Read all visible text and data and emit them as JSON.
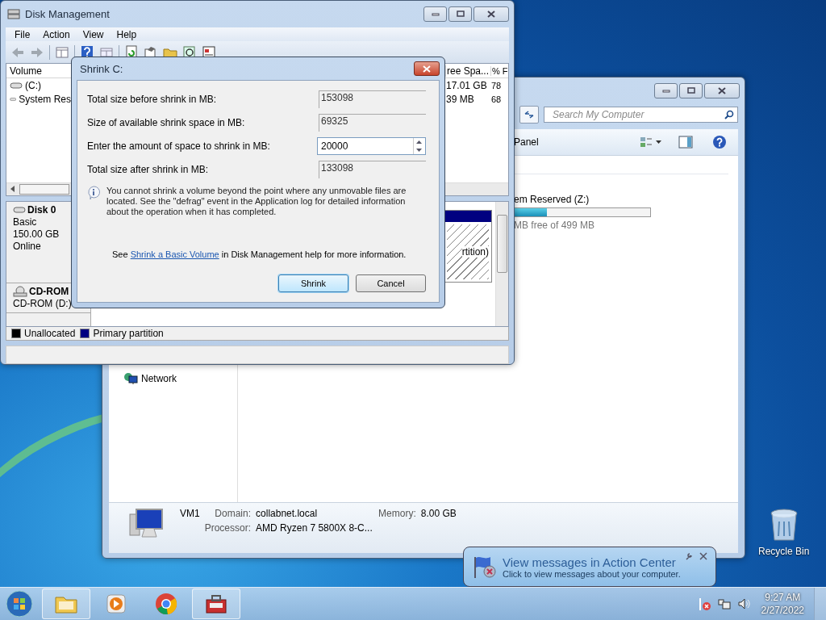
{
  "disk_management": {
    "title": "Disk Management",
    "menu": [
      "File",
      "Action",
      "View",
      "Help"
    ],
    "volume_table": {
      "columns": [
        "Volume",
        "ree Spa...",
        "% F"
      ],
      "rows": [
        {
          "volume": "(C:)",
          "free_space": "17.01 GB",
          "percent_free": "78"
        },
        {
          "volume": "System Res",
          "free_space": "39 MB",
          "percent_free": "68"
        }
      ]
    },
    "disks": [
      {
        "kind": "disk",
        "name": "Disk 0",
        "lines": [
          "Basic",
          "150.00 GB",
          "Online"
        ]
      },
      {
        "kind": "cdrom",
        "name": "CD-ROM",
        "lines": [
          "CD-ROM (D:)"
        ]
      }
    ],
    "partition_label": "rtition)",
    "legend": [
      {
        "label": "Unallocated",
        "color": "#000000"
      },
      {
        "label": "Primary partition",
        "color": "#000080"
      }
    ]
  },
  "shrink_dialog": {
    "title": "Shrink C:",
    "fields": [
      {
        "kind": "readonly",
        "label": "Total size before shrink in MB:",
        "value": "153098"
      },
      {
        "kind": "readonly",
        "label": "Size of available shrink space in MB:",
        "value": "69325"
      },
      {
        "kind": "spin",
        "label": "Enter the amount of space to shrink in MB:",
        "value": "20000"
      },
      {
        "kind": "readonly",
        "label": "Total size after shrink in MB:",
        "value": "133098"
      }
    ],
    "info": "You cannot shrink a volume beyond the point where any unmovable files are located. See the \"defrag\" event in the Application log for detailed information about the operation when it has completed.",
    "help": {
      "before": "See",
      "link": "Shrink a Basic Volume",
      "after": "in Disk Management help for more information."
    },
    "buttons": [
      {
        "label": "Shrink",
        "default": true
      },
      {
        "label": "Cancel",
        "default": false
      }
    ]
  },
  "explorer": {
    "search": {
      "placeholder": "Search My Computer"
    },
    "toolbar_label": "Panel",
    "drive": {
      "name": "em Reserved (Z:)",
      "level": 0.24,
      "free": "MB free of 499 MB"
    },
    "nav": [
      {
        "label": "Network"
      }
    ],
    "details": {
      "name": "VM1",
      "fields": [
        {
          "label": "Domain:",
          "value": "collabnet.local"
        },
        {
          "label": "Memory:",
          "value": "8.00 GB"
        },
        {
          "label": "Processor:",
          "value": "AMD Ryzen 7 5800X 8-C..."
        }
      ]
    }
  },
  "desktop_icons": [
    {
      "label": "Recycle Bin"
    }
  ],
  "notification": {
    "title": "View messages in Action Center",
    "text": "Click to view messages about your computer."
  },
  "taskbar": {
    "time": "9:27 AM",
    "date": "2/27/2022"
  }
}
